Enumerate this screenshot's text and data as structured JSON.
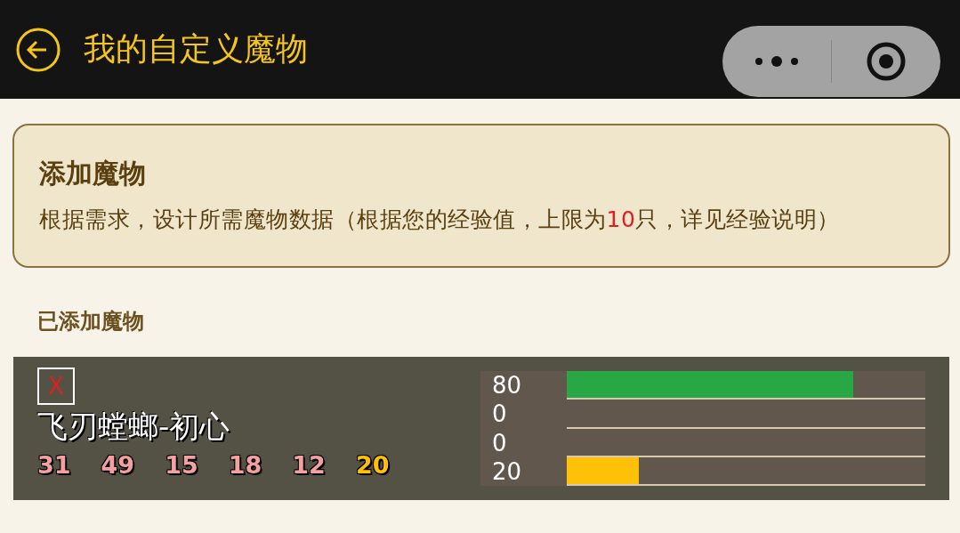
{
  "nav_bar": {
    "title": "我的自定义魔物"
  },
  "add_card": {
    "title": "添加魔物",
    "description": "根据需求，设计所需魔物数据（根据您的经验值，上限为**10**只，详见经验说明）"
  },
  "section_title": "已添加魔物",
  "monsters": [
    {
      "delete_label": "X",
      "name": "飞刃螳螂-初心",
      "stats": [
        {
          "value": "31",
          "color": "#f4a0a0"
        },
        {
          "value": "49",
          "color": "#f4a0a0"
        },
        {
          "value": "15",
          "color": "#f4a0a0"
        },
        {
          "value": "18",
          "color": "#f4a0a0"
        },
        {
          "value": "12",
          "color": "#f4a0a0"
        },
        {
          "value": "20",
          "color": "#ffc107"
        }
      ],
      "bars": [
        {
          "reading": "80",
          "level": 0.8,
          "color": "#28a745"
        },
        {
          "reading": "0"
        },
        {
          "reading": "0"
        },
        {
          "reading": "20",
          "level": 0.2,
          "color": "#ffc107"
        }
      ]
    }
  ]
}
